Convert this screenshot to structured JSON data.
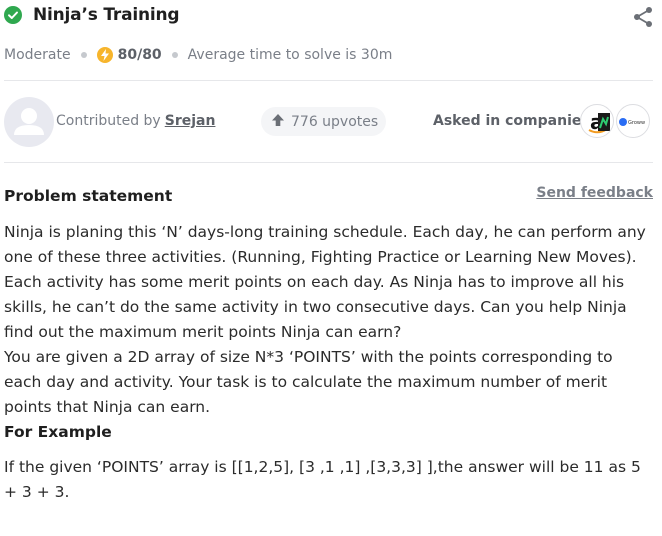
{
  "problem": {
    "title": "Ninja’s Training",
    "difficulty": "Moderate",
    "points": "80/80",
    "avg_time": "Average time to solve is 30m"
  },
  "contributor": {
    "prefix": "Contributed by",
    "name": "Srejan"
  },
  "upvotes": "776 upvotes",
  "companies_label": "Asked in companies",
  "companies": [
    "Amazon",
    "Groww"
  ],
  "statement": {
    "heading": "Problem statement",
    "feedback_link": "Send feedback",
    "paragraph1": "Ninja is planing this ‘N’ days-long training schedule. Each day, he can perform any one of these three activities. (Running, Fighting Practice or Learning New Moves). Each activity has some merit points on each day. As Ninja has to improve all his skills, he can’t do the same activity in two consecutive days. Can you help Ninja find out the maximum merit points Ninja can earn?",
    "paragraph2": "You are given a 2D array of size N*3 ‘POINTS’ with the points corresponding to each day and activity. Your task is to calculate the maximum number of merit points that Ninja can earn.",
    "example_heading": "For Example",
    "example_text": "If the given ‘POINTS’ array is [[1,2,5], [3 ,1 ,1] ,[3,3,3] ],the answer will be 11 as 5 + 3 + 3."
  },
  "colors": {
    "solved_green": "#2fa84f",
    "bolt_yellow": "#f7b52c",
    "muted_text": "#7a7f88"
  },
  "icons": [
    "check-icon",
    "share-icon",
    "bolt-icon",
    "user-icon",
    "upvote-arrow-icon"
  ]
}
